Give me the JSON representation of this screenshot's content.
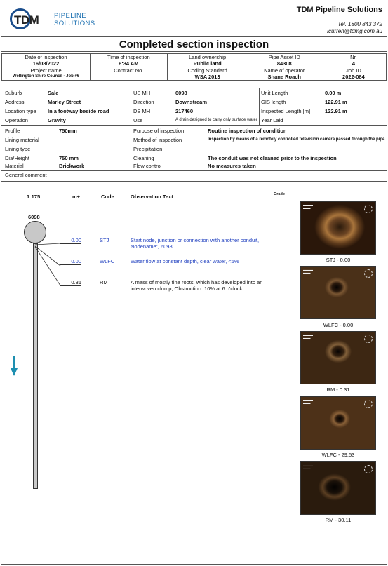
{
  "header": {
    "logo_text": "TDM",
    "logo_sub1": "PIPELINE",
    "logo_sub2": "SOLUTIONS",
    "company": "TDM Pipeline Solutions",
    "tel": "Tel. 1800 843 372",
    "email": "icurren@tdmg.com.au"
  },
  "title": "Completed section inspection",
  "info": {
    "row1": [
      {
        "label": "Date of inspection",
        "value": "16/08/2022"
      },
      {
        "label": "Time of inspection",
        "value": "6:34 AM"
      },
      {
        "label": "Land ownership",
        "value": "Public land"
      },
      {
        "label": "Pipe Asset ID",
        "value": "84308"
      },
      {
        "label": "Nr.",
        "value": "4"
      }
    ],
    "row2": [
      {
        "label": "Project name",
        "value": "Wellington Shire Council - Job #6"
      },
      {
        "label": "Contract No.",
        "value": ""
      },
      {
        "label": "Coding Standard",
        "value": "WSA 2013"
      },
      {
        "label": "Name of operator",
        "value": "Shane Roach"
      },
      {
        "label": "Job ID",
        "value": "2022-084"
      }
    ]
  },
  "details": {
    "suburb": {
      "k": "Suburb",
      "v": "Sale"
    },
    "address": {
      "k": "Address",
      "v": "Marley Street"
    },
    "location_type": {
      "k": "Location type",
      "v": "In a footway beside road"
    },
    "operation": {
      "k": "Operation",
      "v": "Gravity"
    },
    "us_mh": {
      "k": "US MH",
      "v": "6098"
    },
    "direction": {
      "k": "Direction",
      "v": "Downstream"
    },
    "ds_mh": {
      "k": "DS MH",
      "v": "217460"
    },
    "use": {
      "k": "Use",
      "v": "A drain designed to carry only surface water"
    },
    "unit_length": {
      "k": "Unit Length",
      "v": "0.00 m"
    },
    "gis_length": {
      "k": "GIS length",
      "v": "122.91 m"
    },
    "inspected_length": {
      "k": "Inspected Length [m]",
      "v": "122.91 m"
    },
    "year_laid": {
      "k": "Year Laid",
      "v": ""
    },
    "profile": {
      "k": "Profile",
      "v": "750mm"
    },
    "lining_material": {
      "k": "Lining material",
      "v": ""
    },
    "lining_type": {
      "k": "Lining type",
      "v": ""
    },
    "dia_height": {
      "k": "Dia/Height",
      "v": "750 mm"
    },
    "material": {
      "k": "Material",
      "v": "Brickwork"
    },
    "purpose": {
      "k": "Purpose of inspection",
      "v": "Routine inspection of condition"
    },
    "method": {
      "k": "Method of inspection",
      "v": "Inspection by means of a remotely controlled television camera passed through the pipe"
    },
    "precipitation": {
      "k": "Precipitation",
      "v": ""
    },
    "cleaning": {
      "k": "Cleaning",
      "v": "The conduit was not cleaned prior to the inspection"
    },
    "flow_control": {
      "k": "Flow control",
      "v": "No measures taken"
    }
  },
  "general_comment": "General comment",
  "columns": {
    "scale": "1:175",
    "distance": "m+",
    "code": "Code",
    "observation": "Observation Text",
    "grade": "Grade"
  },
  "start_node": "6098",
  "observations": [
    {
      "distance": "0.00",
      "code": "STJ",
      "text": "Start node, junction or connection with another conduit, Nodename:, 6098",
      "color": "#1f3fbf"
    },
    {
      "distance": "0.00",
      "code": "WLFC",
      "text": "Water flow at constant depth, clear water, <5%",
      "color": "#1f3fbf"
    },
    {
      "distance": "0.31",
      "code": "RM",
      "text": "A mass of mostly fine roots, which has developed into an interwoven clump, Obstruction: 10% at 6 o'clock",
      "color": "#111111"
    }
  ],
  "photos": [
    {
      "caption": "STJ - 0.00"
    },
    {
      "caption": "WLFC - 0.00"
    },
    {
      "caption": "RM - 0.31"
    },
    {
      "caption": "WLFC - 29.53"
    },
    {
      "caption": "RM - 30.11"
    }
  ],
  "colors": {
    "accent_blue": "#1f3fbf",
    "logo_blue": "#1a4d8c",
    "flow_arrow": "#1e8fb0"
  }
}
